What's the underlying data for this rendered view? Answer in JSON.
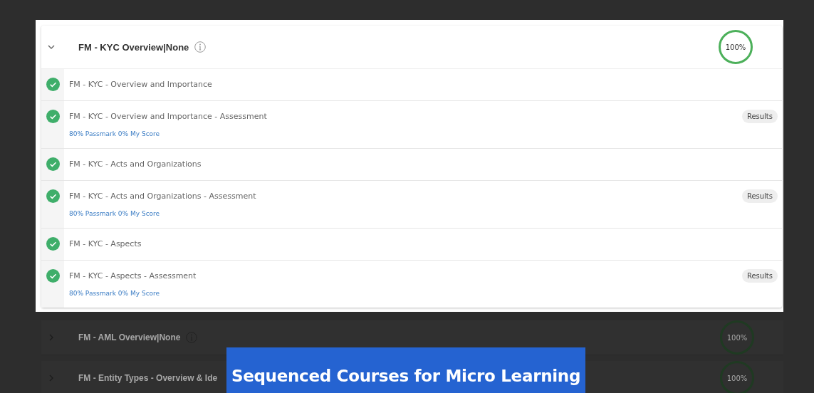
{
  "sections": [
    {
      "title": "FM - KYC Overview|None",
      "info": true,
      "highlighted": true,
      "expanded": true,
      "progress": "100%",
      "items": [
        {
          "kind": "lesson",
          "title": "FM - KYC - Overview and Importance",
          "completed": true
        },
        {
          "kind": "assessment",
          "title": "FM - KYC - Overview and Importance - Assessment",
          "completed": true,
          "score": "80% Passmark 0% My Score",
          "action": "Results"
        },
        {
          "kind": "lesson",
          "title": "FM - KYC - Acts and Organizations",
          "completed": true
        },
        {
          "kind": "assessment",
          "title": "FM - KYC - Acts and Organizations - Assessment",
          "completed": true,
          "score": "80% Passmark 0% My Score",
          "action": "Results"
        },
        {
          "kind": "lesson",
          "title": "FM - KYC - Aspects",
          "completed": true
        },
        {
          "kind": "assessment",
          "title": "FM - KYC - Aspects - Assessment",
          "completed": true,
          "score": "80% Passmark 0% My Score",
          "action": "Results"
        }
      ]
    },
    {
      "title": "FM - AML Overview|None",
      "info": true,
      "highlighted": false,
      "expanded": false,
      "progress": "100%"
    },
    {
      "title": "FM - Entity Types - Overview & Ide",
      "info": false,
      "highlighted": false,
      "expanded": false,
      "progress": "100%"
    }
  ],
  "banner": {
    "text": "Sequenced Courses for Micro Learning"
  }
}
